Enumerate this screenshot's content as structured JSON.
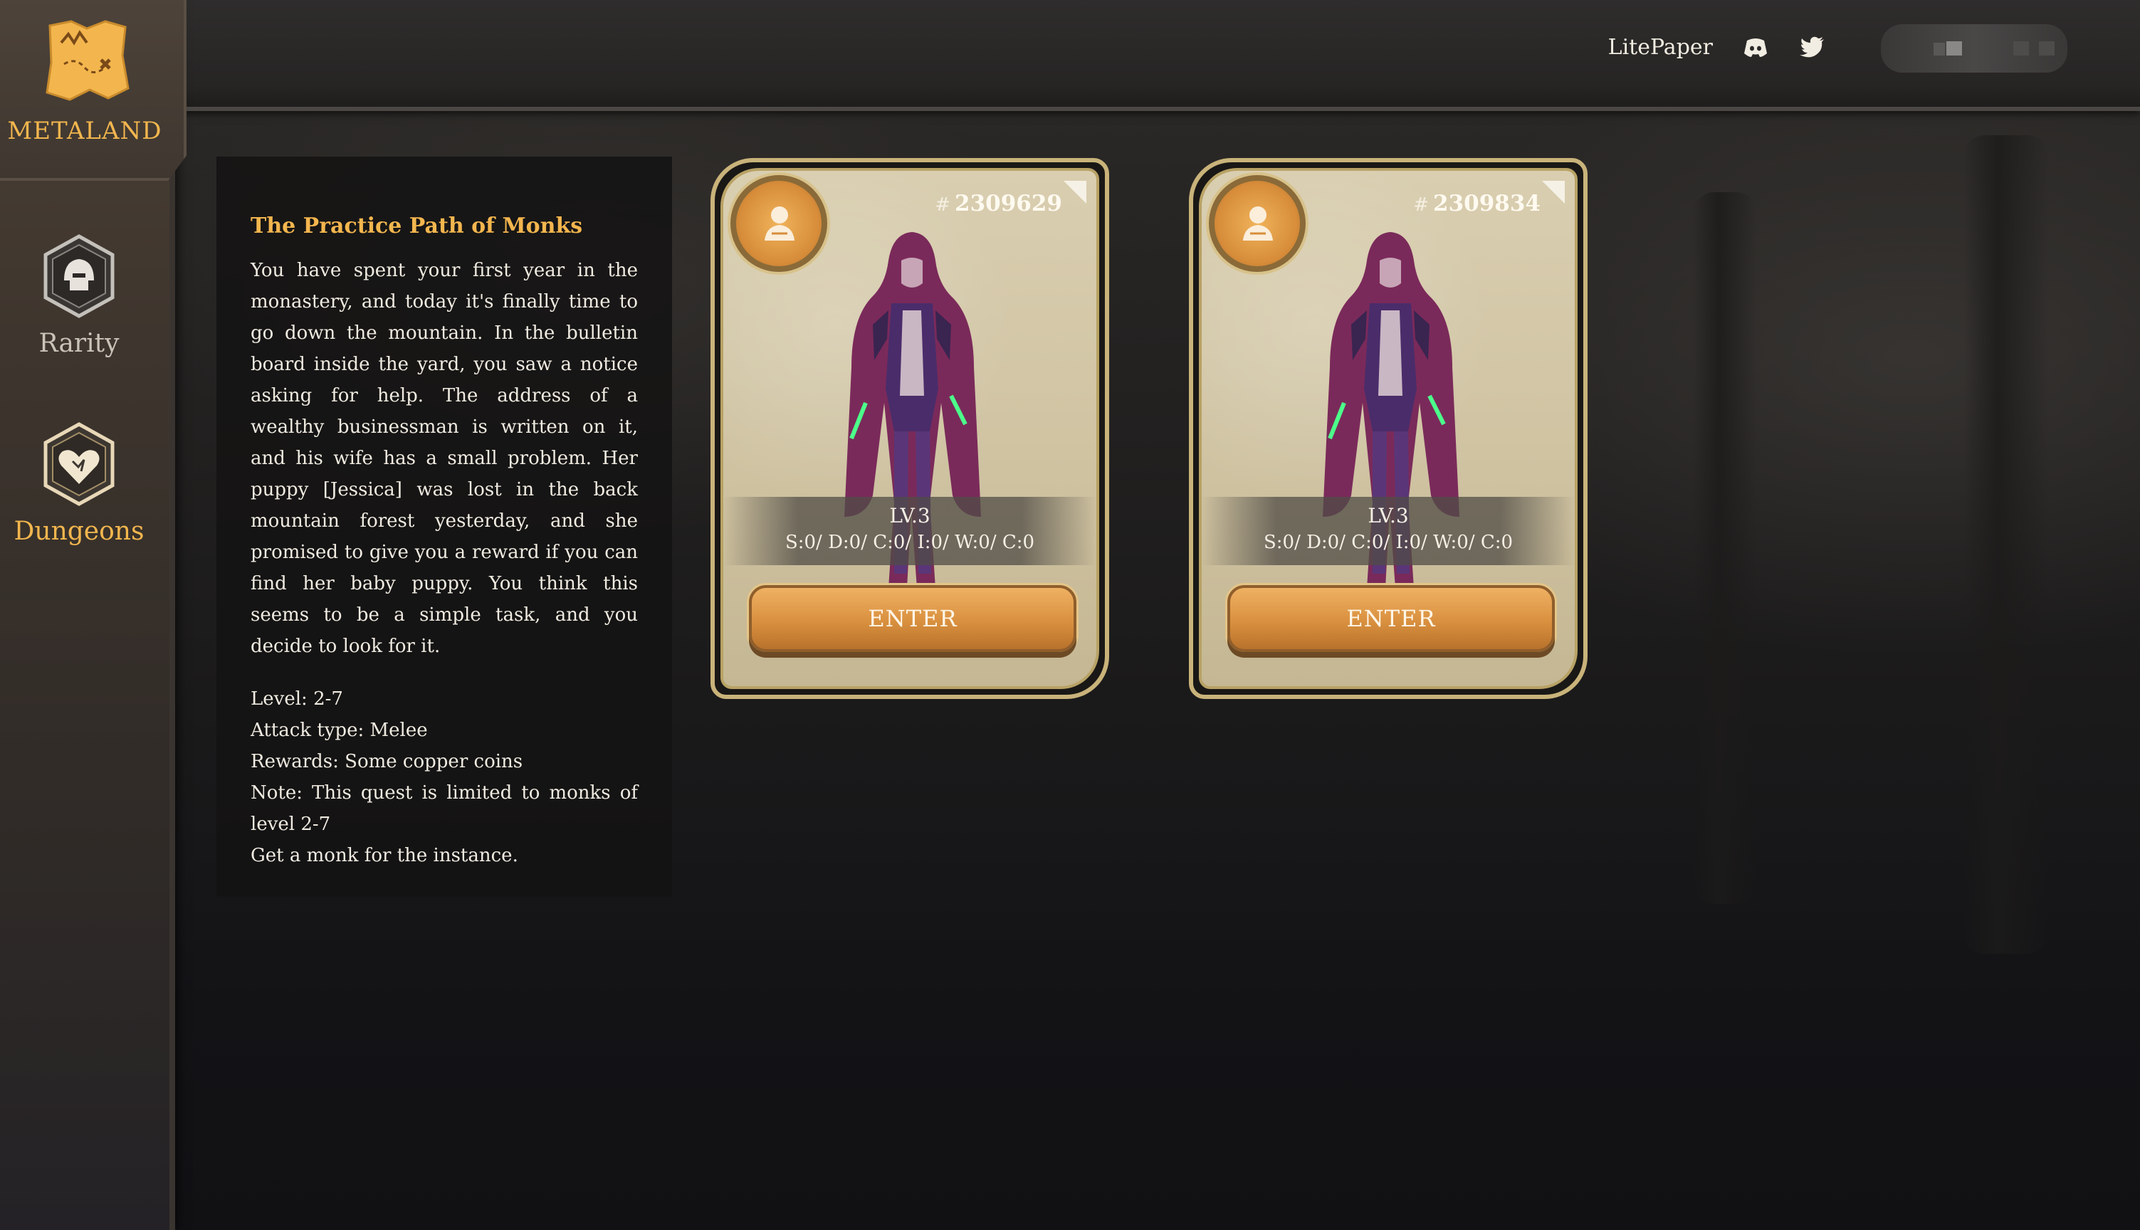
{
  "brand": {
    "name": "METALAND"
  },
  "header": {
    "links": [
      {
        "label": "LitePaper",
        "icon": ""
      },
      {
        "label": "",
        "icon": "discord-icon"
      },
      {
        "label": "",
        "icon": "twitter-icon"
      }
    ],
    "wallet": {
      "label": ""
    }
  },
  "sidebar": {
    "items": [
      {
        "label": "Rarity",
        "icon": "helmet-icon",
        "active": false
      },
      {
        "label": "Dungeons",
        "icon": "heart-shield-icon",
        "active": true
      }
    ]
  },
  "quest": {
    "title": "The Practice Path of Monks",
    "description": "You have spent your first year in the monastery, and today it's finally time to go down the mountain. In the bulletin board inside the yard, you saw a notice asking for help. The address of a wealthy businessman is written on it, and his wife has a small problem. Her puppy [Jessica] was lost in the back mountain forest yesterday, and she promised to give you a reward if you can find her baby puppy. You think this seems to be a simple task, and you decide to look for it.",
    "level": "Level: 2-7",
    "attack_type": "Attack type: Melee",
    "rewards": "Rewards: Some copper coins",
    "note": "Note: This quest is limited to monks of level 2-7",
    "cta": "Get a monk for the instance."
  },
  "cards": [
    {
      "hash": "#",
      "id": "2309629",
      "level": "LV.3",
      "stats": "S:0/ D:0/ C:0/ I:0/ W:0/ C:0",
      "button": "ENTER",
      "badge_icon": "monk-icon"
    },
    {
      "hash": "#",
      "id": "2309834",
      "level": "LV.3",
      "stats": "S:0/ D:0/ C:0/ I:0/ W:0/ C:0",
      "button": "ENTER",
      "badge_icon": "monk-icon"
    }
  ],
  "colors": {
    "accent": "#f3b64e",
    "button": "#d9903f",
    "card": "#cfc3a2",
    "background": "#121215"
  }
}
